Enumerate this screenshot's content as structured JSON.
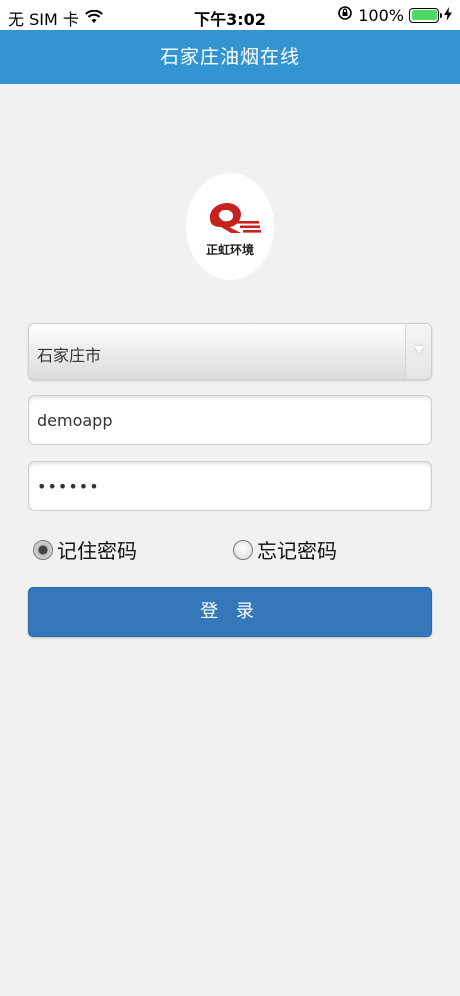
{
  "status_bar": {
    "carrier": "无 SIM 卡",
    "time": "下午3:02",
    "battery": "100%"
  },
  "nav": {
    "title": "石家庄油烟在线"
  },
  "logo": {
    "text": "正虹环境",
    "accent": "#c6201f"
  },
  "form": {
    "city": {
      "selected": "石家庄市"
    },
    "username": {
      "value": "demoapp"
    },
    "password": {
      "value": "••••••"
    },
    "remember_label": "记住密码",
    "forget_label": "忘记密码",
    "remember_selected": true,
    "login_label": "登 录"
  },
  "colors": {
    "nav": "#3394d1",
    "button": "#3478b9",
    "background": "#f1f1f1"
  }
}
